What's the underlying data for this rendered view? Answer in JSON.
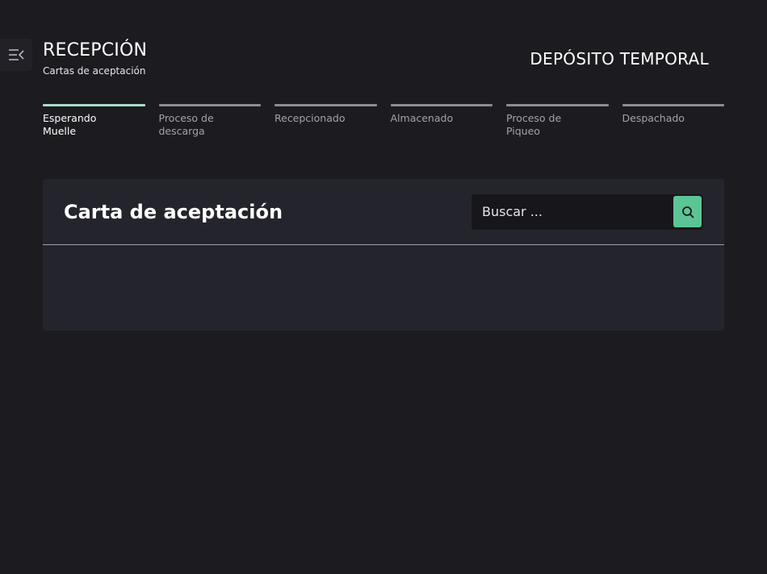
{
  "header": {
    "title": "RECEPCIÓN",
    "subtitle": "Cartas de aceptación",
    "brand": "DEPÓSITO TEMPORAL",
    "menu_icon": "collapse-menu-icon"
  },
  "steps": [
    {
      "label": "Esperando\nMuelle",
      "active": true
    },
    {
      "label": "Proceso de\ndescarga",
      "active": false
    },
    {
      "label": "Recepcionado",
      "active": false
    },
    {
      "label": "Almacenado",
      "active": false
    },
    {
      "label": "Proceso de\nPiqueo",
      "active": false
    },
    {
      "label": "Despachado",
      "active": false
    }
  ],
  "card": {
    "title": "Carta de aceptación",
    "search": {
      "placeholder": "Buscar ...",
      "value": "",
      "icon": "search-icon"
    }
  },
  "colors": {
    "background": "#1b1b20",
    "card": "#24242d",
    "accent": "#5cc595",
    "active_step": "#a8ddc9",
    "inactive_step": "#8c8c92"
  }
}
